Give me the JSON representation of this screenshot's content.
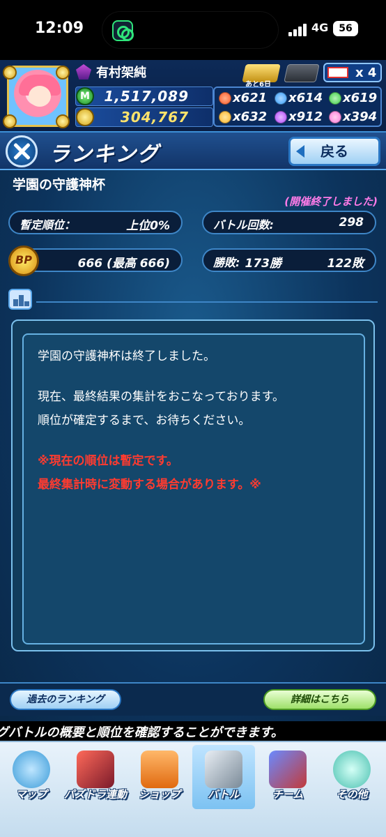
{
  "status_bar": {
    "time": "12:09",
    "network": "4G",
    "battery": "56"
  },
  "header": {
    "player_name": "有村架純",
    "ticket_days": "あと6日",
    "ticket_count": "x 4",
    "money_value": "1,517,089",
    "coin_value": "304,767",
    "orbs": [
      {
        "color": "#ff5a2a",
        "icon": "fire-orb-icon",
        "count": "x621"
      },
      {
        "color": "#3aa0ff",
        "icon": "water-orb-icon",
        "count": "x614"
      },
      {
        "color": "#3fd04a",
        "icon": "wood-orb-icon",
        "count": "x619"
      },
      {
        "color": "#ffb52a",
        "icon": "light-orb-icon",
        "count": "x632"
      },
      {
        "color": "#b44bff",
        "icon": "dark-orb-icon",
        "count": "x912"
      },
      {
        "color": "#ff7ad9",
        "icon": "heart-orb-icon",
        "count": "x394"
      }
    ]
  },
  "titlebar": {
    "title": "ランキング",
    "back_label": "戻る"
  },
  "ranking": {
    "event_title": "学園の守護神杯",
    "event_status": "(開催終了しました)",
    "provisional_rank_label": "暫定順位：",
    "provisional_rank_value": "上位0%",
    "battle_count_label": "バトル回数:",
    "battle_count_value": "298",
    "bp_icon": "BP",
    "bp_value": "666 (最高 666)",
    "record_label": "勝敗:",
    "record_wins": "173勝",
    "record_losses": "122敗"
  },
  "message": {
    "line1": "学園の守護神杯は終了しました。",
    "line2": "現在、最終結果の集計をおこなっております。",
    "line3": "順位が確定するまで、お待ちください。",
    "warning1": "※現在の順位は暫定です。",
    "warning2": "最終集計時に変動する場合があります。※"
  },
  "buttons": {
    "past_ranking": "過去のランキング",
    "details": "詳細はこちら"
  },
  "ticker": {
    "text": "グバトルの概要と順位を確認することができます。"
  },
  "tabs": [
    {
      "label": "マップ",
      "icon": "map-icon",
      "color": "#3a9bd8"
    },
    {
      "label": "パズドラ連動",
      "icon": "dragon-icon",
      "color": "#c23a3a"
    },
    {
      "label": "ショップ",
      "icon": "shopping-bag-icon",
      "color": "#f08a2a"
    },
    {
      "label": "バトル",
      "icon": "crossed-swords-icon",
      "color": "#8a9aa8"
    },
    {
      "label": "チーム",
      "icon": "team-icon",
      "color": "#4a6ad0"
    },
    {
      "label": "その他",
      "icon": "question-icon",
      "color": "#4ac0b0"
    }
  ]
}
